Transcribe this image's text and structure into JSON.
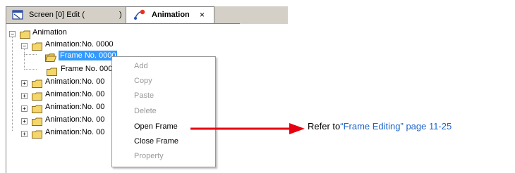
{
  "tabs": [
    {
      "label": "Screen [0] Edit (",
      "close": ")"
    },
    {
      "label": "Animation",
      "close": "×"
    }
  ],
  "tree": {
    "root": "Animation",
    "group_expanded": "Animation:No. 0000",
    "frames": [
      "Frame No. 0000",
      "Frame No. 000"
    ],
    "groups_collapsed": [
      "Animation:No. 00",
      "Animation:No. 00",
      "Animation:No. 00",
      "Animation:No. 00",
      "Animation:No. 00"
    ]
  },
  "context_menu": {
    "items": [
      {
        "label": "Add",
        "enabled": false
      },
      {
        "label": "Copy",
        "enabled": false
      },
      {
        "label": "Paste",
        "enabled": false
      },
      {
        "label": "Delete",
        "enabled": false
      },
      {
        "label": "Open Frame",
        "enabled": true
      },
      {
        "label": "Close Frame",
        "enabled": true
      },
      {
        "label": "Property",
        "enabled": false
      }
    ]
  },
  "note": {
    "prefix": "Refer to",
    "link": "“Frame Editing” page 11-25"
  },
  "colors": {
    "arrow": "#e60012",
    "link": "#1e64c8",
    "selection": "#3399ff",
    "folder": "#f5d66b"
  }
}
